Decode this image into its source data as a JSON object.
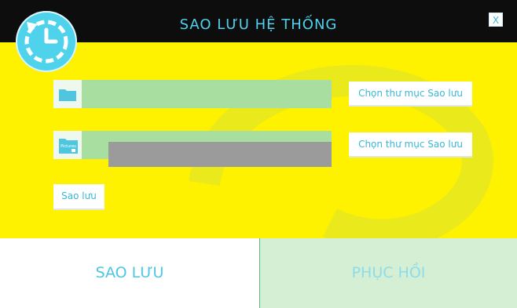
{
  "window": {
    "title": "SAO LƯU HỆ THỐNG",
    "close_label": "X"
  },
  "logo": {
    "icon": "backup-clock-icon"
  },
  "backup_source": {
    "value": "",
    "icon": "folder-icon",
    "button_label": "Chọn thư mục Sao lưu"
  },
  "backup_target": {
    "value": "",
    "icon": "pictures-folder-icon",
    "icon_text": "Pictures",
    "button_label": "Chọn thư mục Sao lưu"
  },
  "action": {
    "button_label": "Sao lưu",
    "progress": 0
  },
  "tabs": [
    {
      "label": "SAO LƯU",
      "active": true
    },
    {
      "label": "PHỤC HỒI",
      "active": false
    }
  ],
  "colors": {
    "accent": "#4fd2ec",
    "panel": "#fff200",
    "field": "#a8dfa0",
    "titlebar": "#0d0d0d"
  }
}
